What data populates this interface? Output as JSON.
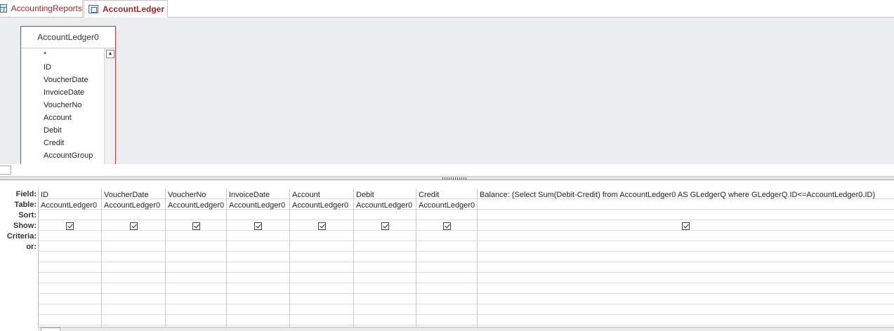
{
  "tabs": [
    {
      "label": "AccountingReports",
      "icon": "table-icon",
      "active": false
    },
    {
      "label": "AccountLedger",
      "icon": "query-icon",
      "active": true
    }
  ],
  "field_list": {
    "title": "AccountLedger0",
    "items": [
      "*",
      "ID",
      "VoucherDate",
      "InvoiceDate",
      "VoucherNo",
      "Account",
      "Debit",
      "Credit",
      "AccountGroup"
    ]
  },
  "row_headers": [
    "Field:",
    "Table:",
    "Sort:",
    "Show:",
    "Criteria:",
    "or:"
  ],
  "columns": [
    {
      "field": "ID",
      "table": "AccountLedger0",
      "show": true
    },
    {
      "field": "VoucherDate",
      "table": "AccountLedger0",
      "show": true
    },
    {
      "field": "VoucherNo",
      "table": "AccountLedger0",
      "show": true
    },
    {
      "field": "InvoiceDate",
      "table": "AccountLedger0",
      "show": true
    },
    {
      "field": "Account",
      "table": "AccountLedger0",
      "show": true
    },
    {
      "field": "Debit",
      "table": "AccountLedger0",
      "show": true
    },
    {
      "field": "Credit",
      "table": "AccountLedger0",
      "show": true
    },
    {
      "field": "Balance: (Select Sum(Debit-Credit) from AccountLedger0 AS GLedgerQ where GLedgerQ.ID<=AccountLedger0.ID)",
      "table": "",
      "show": true
    }
  ]
}
